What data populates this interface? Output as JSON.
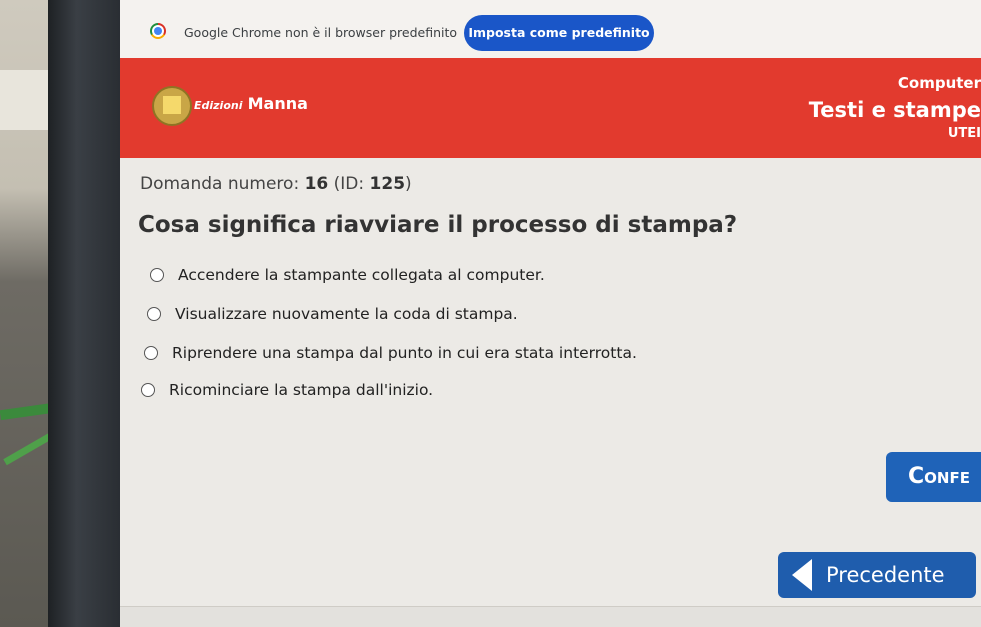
{
  "infobar": {
    "message": "Google Chrome non è il browser predefinito",
    "action_label": "Imposta come predefinito"
  },
  "header": {
    "brand_prefix": "Edizioni",
    "brand_name": "Manna",
    "line1": "Computer",
    "line2": "Testi e stampe",
    "line3": "UTEI"
  },
  "question": {
    "number_label": "Domanda numero:",
    "number": "16",
    "id_label": "(ID:",
    "id": "125",
    "id_close": ")",
    "text": "Cosa significa riavviare il processo di stampa?"
  },
  "options": [
    "Accendere la stampante collegata al computer.",
    "Visualizzare nuovamente la coda di stampa.",
    "Riprendere una stampa dal punto in cui era stata interrotta.",
    "Ricominciare la stampa dall'inizio."
  ],
  "buttons": {
    "confirm_label": "Confe",
    "previous_label": "Precedente"
  },
  "colors": {
    "header_red": "#e23a2e",
    "button_blue": "#1f63b8",
    "infobar_button": "#1a56c8"
  }
}
